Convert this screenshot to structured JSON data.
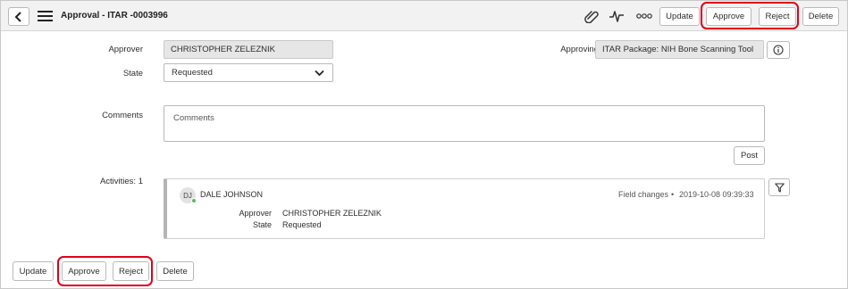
{
  "header": {
    "title": "Approval - ITAR -0003996",
    "update_label": "Update",
    "approve_label": "Approve",
    "reject_label": "Reject",
    "delete_label": "Delete"
  },
  "form": {
    "approver_label": "Approver",
    "approver_value": "CHRISTOPHER ZELEZNIK",
    "state_label": "State",
    "state_value": "Requested",
    "approving_label": "Approving",
    "approving_value": "ITAR Package: NIH Bone Scanning Tool",
    "comments_label": "Comments",
    "comments_placeholder": "Comments",
    "post_label": "Post"
  },
  "activities": {
    "label": "Activities: 1",
    "items": [
      {
        "initials": "DJ",
        "user": "DALE JOHNSON",
        "type": "Field changes",
        "separator": "•",
        "timestamp": "2019-10-08 09:39:33",
        "fields": [
          {
            "name": "Approver",
            "value": "CHRISTOPHER ZELEZNIK"
          },
          {
            "name": "State",
            "value": "Requested"
          }
        ]
      }
    ]
  },
  "footer": {
    "update_label": "Update",
    "approve_label": "Approve",
    "reject_label": "Reject",
    "delete_label": "Delete"
  },
  "colors": {
    "highlight": "#e0001b",
    "header_bg": "#f2f2f2",
    "readonly_bg": "#e6e6e6",
    "presence": "#5cb85c"
  }
}
